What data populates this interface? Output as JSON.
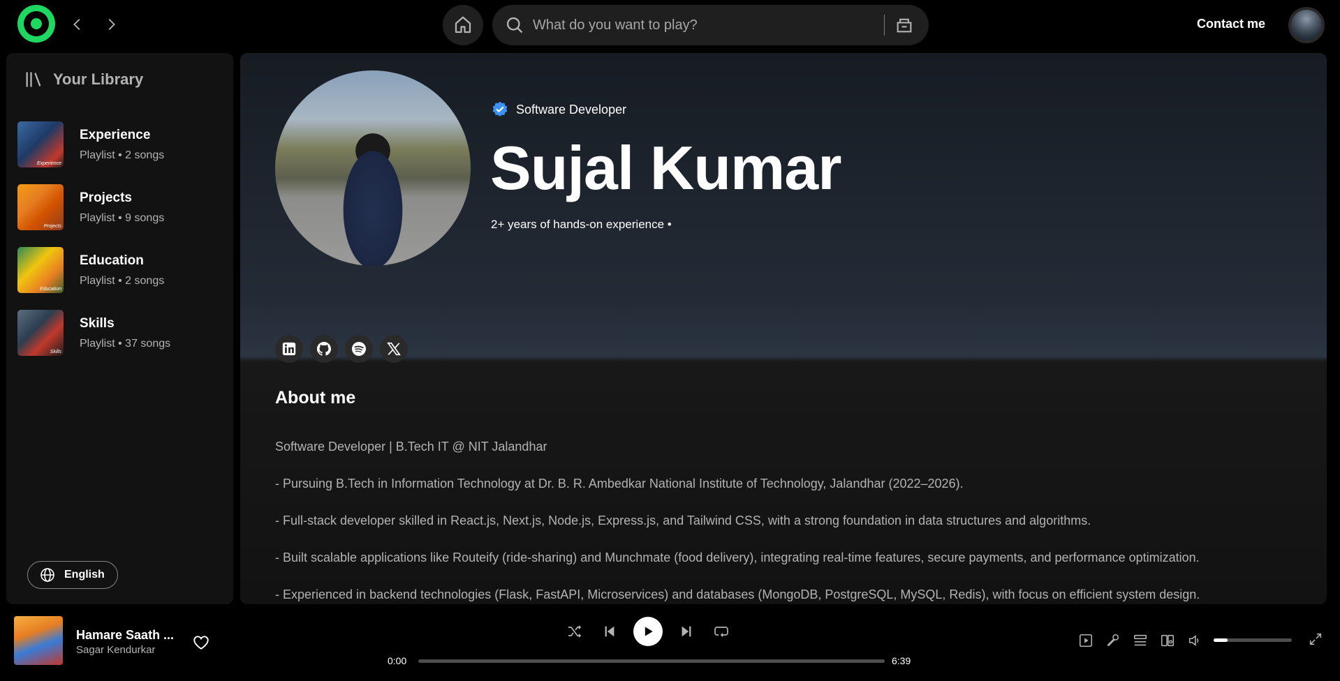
{
  "header": {
    "search_placeholder": "What do you want to play?",
    "contact_label": "Contact me"
  },
  "sidebar": {
    "title": "Your Library",
    "items": [
      {
        "name": "Experience",
        "meta": "Playlist • 2 songs",
        "badge": "Experience"
      },
      {
        "name": "Projects",
        "meta": "Playlist • 9 songs",
        "badge": "Projects"
      },
      {
        "name": "Education",
        "meta": "Playlist • 2 songs",
        "badge": "Education"
      },
      {
        "name": "Skills",
        "meta": "Playlist • 37 songs",
        "badge": "Skills"
      }
    ],
    "language_label": "English"
  },
  "profile": {
    "verified_label": "Software Developer",
    "name": "Sujal Kumar",
    "subtitle": "2+ years of hands-on experience •"
  },
  "socials": [
    "linkedin-icon",
    "github-icon",
    "spotify-icon",
    "x-icon"
  ],
  "about": {
    "title": "About me",
    "lines": [
      "Software Developer | B.Tech IT @ NIT Jalandhar",
      "- Pursuing B.Tech in Information Technology at Dr. B. R. Ambedkar National Institute of Technology, Jalandhar (2022–2026).",
      "- Full-stack developer skilled in React.js, Next.js, Node.js, Express.js, and Tailwind CSS, with a strong foundation in data structures and algorithms.",
      "- Built scalable applications like Routeify (ride-sharing) and Munchmate (food delivery), integrating real-time features, secure payments, and performance optimization.",
      "- Experienced in backend technologies (Flask, FastAPI, Microservices) and databases (MongoDB, PostgreSQL, MySQL, Redis), with focus on efficient system design."
    ]
  },
  "player": {
    "track_title": "Hamare Saath ...",
    "artist": "Sagar Kendurkar",
    "elapsed": "0:00",
    "total": "6:39",
    "progress_fraction": 0,
    "volume_fraction": 0.18
  },
  "colors": {
    "accent": "#1ed760",
    "verified": "#3d91f4"
  }
}
